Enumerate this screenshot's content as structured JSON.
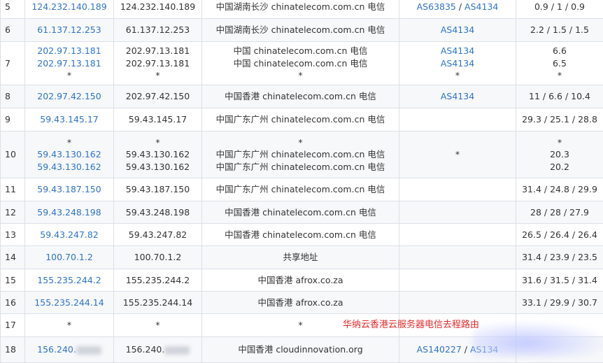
{
  "rows": [
    {
      "hop": "5",
      "ip_links": [
        "124.232.140.189"
      ],
      "ips": [
        "124.232.140.189"
      ],
      "locations": [
        "中国湖南长沙 chinatelecom.com.cn 电信"
      ],
      "asn": [
        [
          "AS63835",
          "AS4134"
        ]
      ],
      "latency": [
        "0.9 / 1 / 0.9"
      ]
    },
    {
      "hop": "6",
      "ip_links": [
        "61.137.12.253"
      ],
      "ips": [
        "61.137.12.253"
      ],
      "locations": [
        "中国湖南长沙 chinatelecom.com.cn 电信"
      ],
      "asn": [
        [
          "AS4134"
        ]
      ],
      "latency": [
        "2.2 / 1.5 / 1.5"
      ]
    },
    {
      "hop": "7",
      "ip_links": [
        "202.97.13.181",
        "202.97.13.181",
        "*"
      ],
      "ips": [
        "202.97.13.181",
        "202.97.13.181",
        "*"
      ],
      "locations": [
        "中国 chinatelecom.com.cn 电信",
        "中国 chinatelecom.com.cn 电信",
        "*"
      ],
      "asn": [
        [
          "AS4134"
        ],
        [
          "AS4134"
        ],
        [
          "*"
        ]
      ],
      "latency": [
        "6.6",
        "6.5",
        "*"
      ]
    },
    {
      "hop": "8",
      "ip_links": [
        "202.97.42.150"
      ],
      "ips": [
        "202.97.42.150"
      ],
      "locations": [
        "中国香港 chinatelecom.com.cn 电信"
      ],
      "asn": [
        [
          "AS4134"
        ]
      ],
      "latency": [
        "11 / 6.6 / 10.4"
      ]
    },
    {
      "hop": "9",
      "ip_links": [
        "59.43.145.17"
      ],
      "ips": [
        "59.43.145.17"
      ],
      "locations": [
        "中国广东广州 chinatelecom.com.cn 电信"
      ],
      "asn": [
        []
      ],
      "latency": [
        "29.3 / 25.1 / 28.8"
      ]
    },
    {
      "hop": "10",
      "ip_links": [
        "*",
        "59.43.130.162",
        "59.43.130.162"
      ],
      "ips": [
        "*",
        "59.43.130.162",
        "59.43.130.162"
      ],
      "locations": [
        "*",
        "中国广东广州 chinatelecom.com.cn 电信",
        "中国广东广州 chinatelecom.com.cn 电信"
      ],
      "asn": [
        [
          "*"
        ]
      ],
      "latency": [
        "*",
        "20.3",
        "20.2"
      ]
    },
    {
      "hop": "11",
      "ip_links": [
        "59.43.187.150"
      ],
      "ips": [
        "59.43.187.150"
      ],
      "locations": [
        "中国广东广州 chinatelecom.com.cn 电信"
      ],
      "asn": [
        []
      ],
      "latency": [
        "31.4 / 24.8 / 29.9"
      ]
    },
    {
      "hop": "12",
      "ip_links": [
        "59.43.248.198"
      ],
      "ips": [
        "59.43.248.198"
      ],
      "locations": [
        "中国香港 chinatelecom.com.cn 电信"
      ],
      "asn": [
        []
      ],
      "latency": [
        "28 / 28 / 27.9"
      ]
    },
    {
      "hop": "13",
      "ip_links": [
        "59.43.247.82"
      ],
      "ips": [
        "59.43.247.82"
      ],
      "locations": [
        "中国香港 chinatelecom.com.cn 电信"
      ],
      "asn": [
        []
      ],
      "latency": [
        "26.5 / 26.4 / 26.4"
      ]
    },
    {
      "hop": "14",
      "ip_links": [
        "100.70.1.2"
      ],
      "ips": [
        "100.70.1.2"
      ],
      "locations": [
        "共享地址"
      ],
      "asn": [
        []
      ],
      "latency": [
        "31.4 / 23.9 / 23.5"
      ]
    },
    {
      "hop": "15",
      "ip_links": [
        "155.235.244.2"
      ],
      "ips": [
        "155.235.244.2"
      ],
      "locations": [
        "中国香港 afrox.co.za"
      ],
      "asn": [
        []
      ],
      "latency": [
        "31.6 / 31.5 / 31.4"
      ]
    },
    {
      "hop": "16",
      "ip_links": [
        "155.235.244.14"
      ],
      "ips": [
        "155.235.244.14"
      ],
      "locations": [
        "中国香港 afrox.co.za"
      ],
      "asn": [
        []
      ],
      "latency": [
        "33.1 / 29.9 / 30.7"
      ]
    },
    {
      "hop": "17",
      "ip_links": [
        "*"
      ],
      "ips": [
        "*"
      ],
      "locations": [
        "*"
      ],
      "asn": [
        []
      ],
      "latency": [
        ""
      ]
    },
    {
      "hop": "18",
      "ip_links": [
        "156.240."
      ],
      "ips": [
        "156.240."
      ],
      "locations": [
        "中国香港 cloudinnovation.org"
      ],
      "asn": [
        [
          "AS140227",
          "AS134"
        ]
      ],
      "latency": [
        ""
      ],
      "redacted": true
    }
  ],
  "watermark": "华纳云香港云服务器电信去程路由",
  "colors": {
    "link": "#2f74c5",
    "watermark": "#e42b2b",
    "border": "#dcdfe6",
    "stripe": "#f7f8fa"
  }
}
